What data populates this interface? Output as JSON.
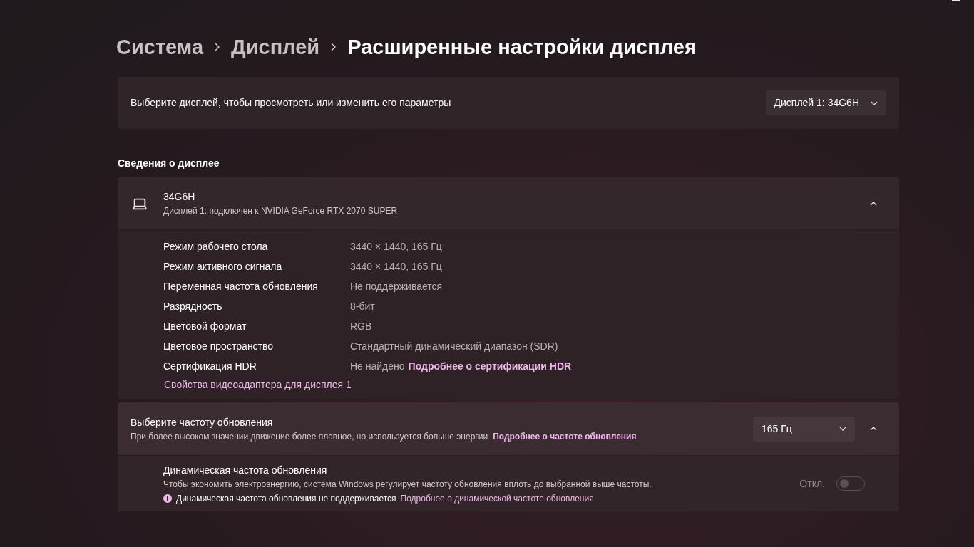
{
  "breadcrumb": [
    {
      "label": "Система",
      "current": false
    },
    {
      "label": "Дисплей",
      "current": false
    },
    {
      "label": "Расширенные настройки дисплея",
      "current": true
    }
  ],
  "display_select": {
    "label": "Выберите дисплей, чтобы просмотреть или изменить его параметры",
    "value": "Дисплей 1: 34G6H"
  },
  "section_title": "Сведения о дисплее",
  "display_info": {
    "name": "34G6H",
    "subtitle": "Дисплей 1: подключен к NVIDIA GeForce RTX 2070 SUPER",
    "expanded": true,
    "rows": [
      {
        "label": "Режим рабочего стола",
        "value": "3440 × 1440, 165 Гц"
      },
      {
        "label": "Режим активного сигнала",
        "value": "3440 × 1440, 165 Гц"
      },
      {
        "label": "Переменная частота обновления",
        "value": "Не поддерживается"
      },
      {
        "label": "Разрядность",
        "value": "8-бит"
      },
      {
        "label": "Цветовой формат",
        "value": "RGB"
      },
      {
        "label": "Цветовое пространство",
        "value": "Стандартный динамический диапазон (SDR)"
      },
      {
        "label": "Сертификация HDR",
        "value": "Не найдено",
        "link": "Подробнее о сертификации HDR"
      }
    ],
    "adapter_link": "Свойства видеоадаптера для дисплея 1"
  },
  "refresh_rate": {
    "title": "Выберите частоту обновления",
    "description": "При более высоком значении движение более плавное, но используется больше энергии",
    "link": "Подробнее о частоте обновления",
    "value": "165 Гц",
    "expanded": true,
    "dynamic": {
      "title": "Динамическая частота обновления",
      "description": "Чтобы экономить электроэнергию, система Windows регулирует частоту обновления вплоть до выбранной выше частоты.",
      "warning": "Динамическая частота обновления не поддерживается",
      "link": "Подробнее о динамической частоте обновления",
      "state_label": "Откл.",
      "on": false
    }
  }
}
